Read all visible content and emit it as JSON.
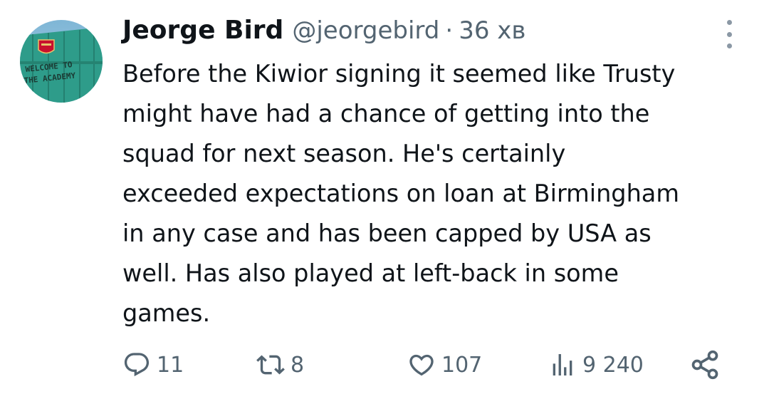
{
  "tweet": {
    "author_name": "Jeorge Bird",
    "handle": "@jeorgebird",
    "separator": "·",
    "time": "36 хв",
    "text": "Before the Kiwior signing it seemed like Trusty\nmight have had a chance of getting into the\nsquad for next season. He's certainly\nexceeded expectations on loan at Birmingham\nin any case and has been capped by USA as\nwell. Has also played at left-back in some\ngames."
  },
  "avatar": {
    "sign_line1": "WELCOME TO",
    "sign_line2": "THE ACADEMY"
  },
  "actions": {
    "replies": "11",
    "retweets": "8",
    "likes": "107",
    "views": "9 240"
  },
  "icons": {
    "reply": "speech-bubble-icon",
    "retweet": "retweet-arrows-icon",
    "like": "heart-icon",
    "views": "bar-chart-icon",
    "share": "share-icon",
    "more": "more-vertical-icon"
  },
  "colors": {
    "text": "#0f1419",
    "secondary": "#536471",
    "avatar_bg": "#2e9c8a"
  }
}
